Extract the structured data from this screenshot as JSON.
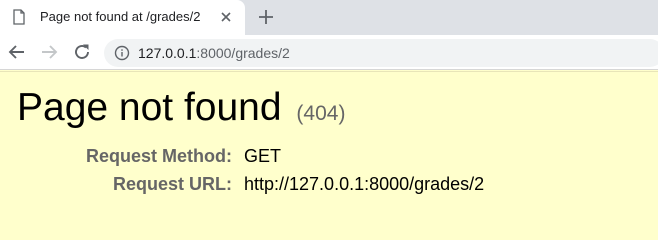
{
  "tab": {
    "title": "Page not found at /grades/2",
    "favicon": "page-icon",
    "close_icon": "close-icon"
  },
  "new_tab_icon": "plus-icon",
  "toolbar": {
    "back_icon": "arrow-left-icon",
    "forward_icon": "arrow-right-icon",
    "reload_icon": "reload-icon",
    "info_icon": "info-icon",
    "url_host": "127.0.0.1",
    "url_rest": ":8000/grades/2"
  },
  "page": {
    "title": "Page not found",
    "status": "(404)",
    "rows": [
      {
        "key": "Request Method:",
        "value": "GET"
      },
      {
        "key": "Request URL:",
        "value": "http://127.0.0.1:8000/grades/2"
      }
    ]
  },
  "colors": {
    "page_background": "#ffffcc",
    "tabstrip": "#dee1e6",
    "key_text": "#666666"
  }
}
